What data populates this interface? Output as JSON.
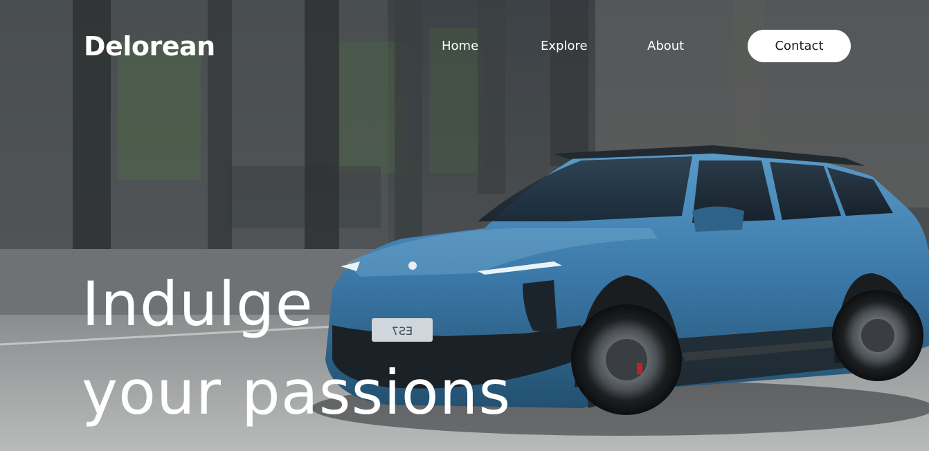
{
  "header": {
    "brand": "Delorean",
    "nav": [
      {
        "label": "Home"
      },
      {
        "label": "Explore"
      },
      {
        "label": "About"
      }
    ],
    "contact_label": "Contact"
  },
  "hero": {
    "headline_line1": "Indulge",
    "headline_line2": "your passions",
    "image": {
      "subject": "blue electric SUV",
      "plate_text": "ES7"
    }
  },
  "colors": {
    "text": "#ffffff",
    "button_bg": "#ffffff",
    "button_text": "#1a1a1a",
    "car_blue": "#3b78a8"
  }
}
